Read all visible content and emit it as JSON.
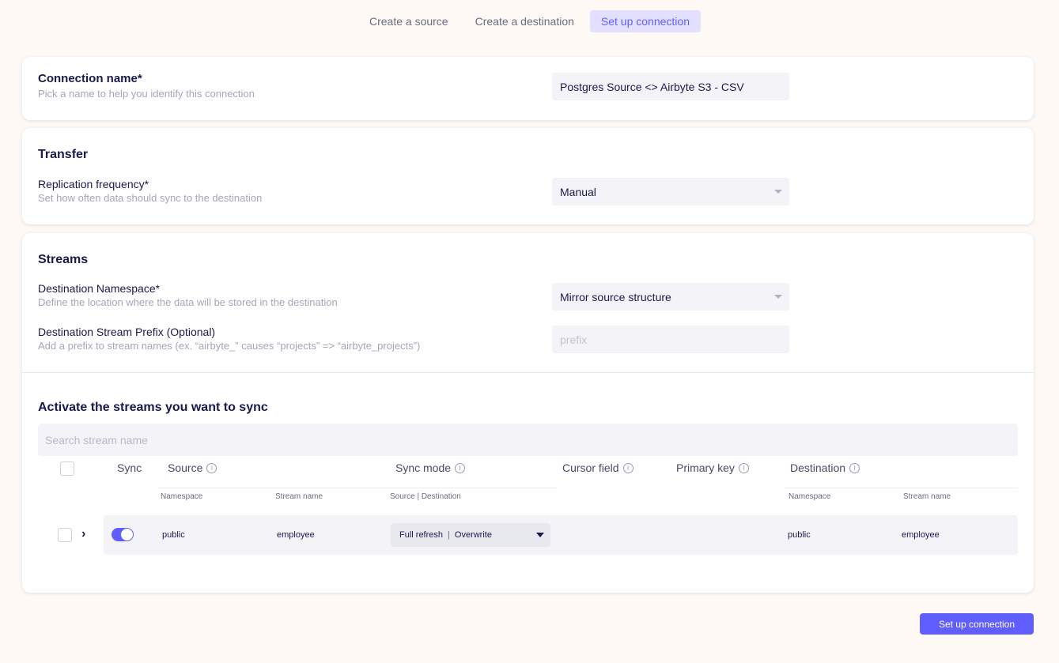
{
  "steps": [
    {
      "label": "Create a source"
    },
    {
      "label": "Create a destination"
    },
    {
      "label": "Set up connection"
    }
  ],
  "connection": {
    "label": "Connection name*",
    "description": "Pick a name to help you identify this connection",
    "value": "Postgres Source <> Airbyte S3 - CSV"
  },
  "transfer": {
    "title": "Transfer",
    "frequency_label": "Replication frequency*",
    "frequency_description": "Set how often data should sync to the destination",
    "frequency_value": "Manual"
  },
  "streams": {
    "title": "Streams",
    "namespace_label": "Destination Namespace*",
    "namespace_description": "Define the location where the data will be stored in the destination",
    "namespace_value": "Mirror source structure",
    "prefix_label": "Destination Stream Prefix (Optional)",
    "prefix_description": "Add a prefix to stream names (ex. “airbyte_” causes “projects” => “airbyte_projects”)",
    "prefix_placeholder": "prefix",
    "activate_title": "Activate the streams you want to sync",
    "search_placeholder": "Search stream name",
    "columns": {
      "sync": "Sync",
      "source": "Source",
      "sync_mode": "Sync mode",
      "cursor_field": "Cursor field",
      "primary_key": "Primary key",
      "destination": "Destination"
    },
    "subcolumns": {
      "src_namespace": "Namespace",
      "src_stream": "Stream name",
      "mode": "Source | Destination",
      "dst_namespace": "Namespace",
      "dst_stream": "Stream name"
    },
    "rows": [
      {
        "src_namespace": "public",
        "src_stream": "employee",
        "mode_source": "Full refresh",
        "mode_sep": "|",
        "mode_destination": "Overwrite",
        "dst_namespace": "public",
        "dst_stream": "employee",
        "enabled": true
      }
    ]
  },
  "submit_label": "Set up connection",
  "colors": {
    "accent": "#615eff",
    "background": "#fef9f4"
  }
}
